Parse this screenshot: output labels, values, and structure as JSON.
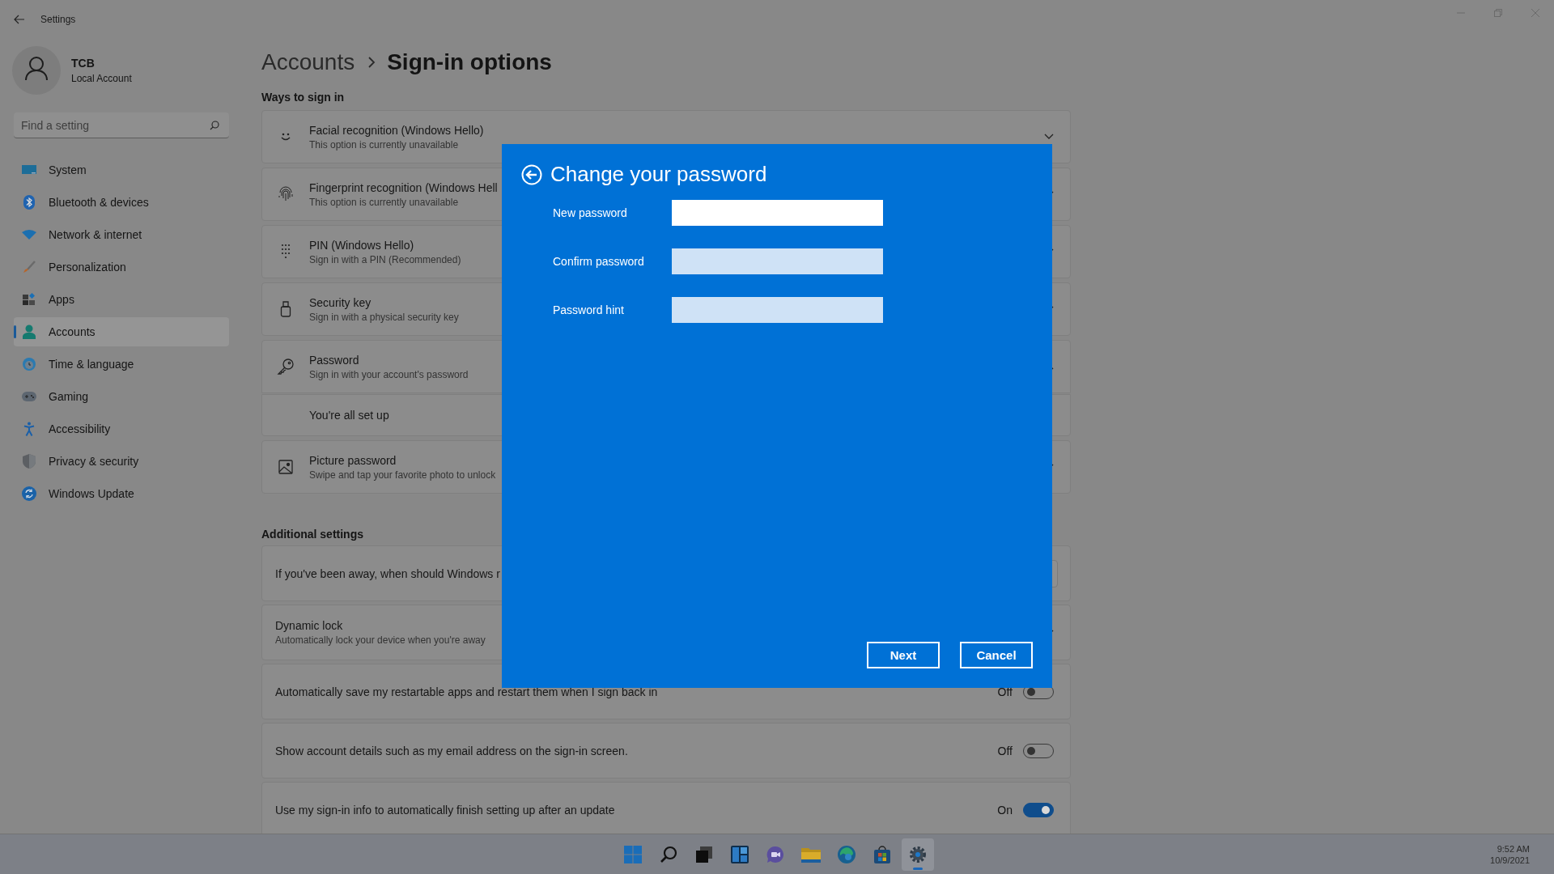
{
  "window": {
    "title": "Settings"
  },
  "profile": {
    "name": "TCB",
    "account_type": "Local Account"
  },
  "search": {
    "placeholder": "Find a setting"
  },
  "nav": [
    {
      "label": "System",
      "selected": false
    },
    {
      "label": "Bluetooth & devices",
      "selected": false
    },
    {
      "label": "Network & internet",
      "selected": false
    },
    {
      "label": "Personalization",
      "selected": false
    },
    {
      "label": "Apps",
      "selected": false
    },
    {
      "label": "Accounts",
      "selected": true
    },
    {
      "label": "Time & language",
      "selected": false
    },
    {
      "label": "Gaming",
      "selected": false
    },
    {
      "label": "Accessibility",
      "selected": false
    },
    {
      "label": "Privacy & security",
      "selected": false
    },
    {
      "label": "Windows Update",
      "selected": false
    }
  ],
  "breadcrumb": [
    "Accounts",
    "Sign-in options"
  ],
  "sign_in": {
    "heading": "Ways to sign in",
    "options": [
      {
        "title": "Facial recognition (Windows Hello)",
        "subtitle": "This option is currently unavailable",
        "expanded": false
      },
      {
        "title": "Fingerprint recognition (Windows Hell",
        "subtitle": "This option is currently unavailable",
        "expanded": false
      },
      {
        "title": "PIN (Windows Hello)",
        "subtitle": "Sign in with a PIN (Recommended)",
        "expanded": false
      },
      {
        "title": "Security key",
        "subtitle": "Sign in with a physical security key",
        "expanded": false
      },
      {
        "title": "Password",
        "subtitle": "Sign in with your account's password",
        "expanded": true,
        "detail": "You're all set up"
      },
      {
        "title": "Picture password",
        "subtitle": "Swipe and tap your favorite photo to unlock",
        "expanded": false
      }
    ]
  },
  "additional": {
    "heading": "Additional settings",
    "items": [
      {
        "kind": "dropdown",
        "title": "If you've been away, when should Windows r"
      },
      {
        "kind": "expander",
        "title": "Dynamic lock",
        "subtitle": "Automatically lock your device when you're away"
      },
      {
        "kind": "toggle",
        "title": "Automatically save my restartable apps and restart them when I sign back in",
        "on": false,
        "state_label": "Off"
      },
      {
        "kind": "toggle",
        "title": "Show account details such as my email address on the sign-in screen.",
        "on": false,
        "state_label": "Off"
      },
      {
        "kind": "toggle",
        "title": "Use my sign-in info to automatically finish setting up after an update",
        "on": true,
        "state_label": "On"
      }
    ]
  },
  "dialog": {
    "title": "Change your password",
    "fields": [
      {
        "label": "New password",
        "focused": true
      },
      {
        "label": "Confirm password",
        "focused": false
      },
      {
        "label": "Password hint",
        "focused": false
      }
    ],
    "buttons": [
      "Next",
      "Cancel"
    ]
  },
  "taskbar": {
    "apps": [
      {
        "selected": false
      },
      {
        "selected": false
      },
      {
        "selected": false
      },
      {
        "selected": false
      },
      {
        "selected": false
      },
      {
        "selected": false
      },
      {
        "selected": false
      },
      {
        "selected": false
      },
      {
        "selected": true
      }
    ],
    "clock": {
      "time": "9:52 AM",
      "date": "10/9/2021"
    }
  }
}
